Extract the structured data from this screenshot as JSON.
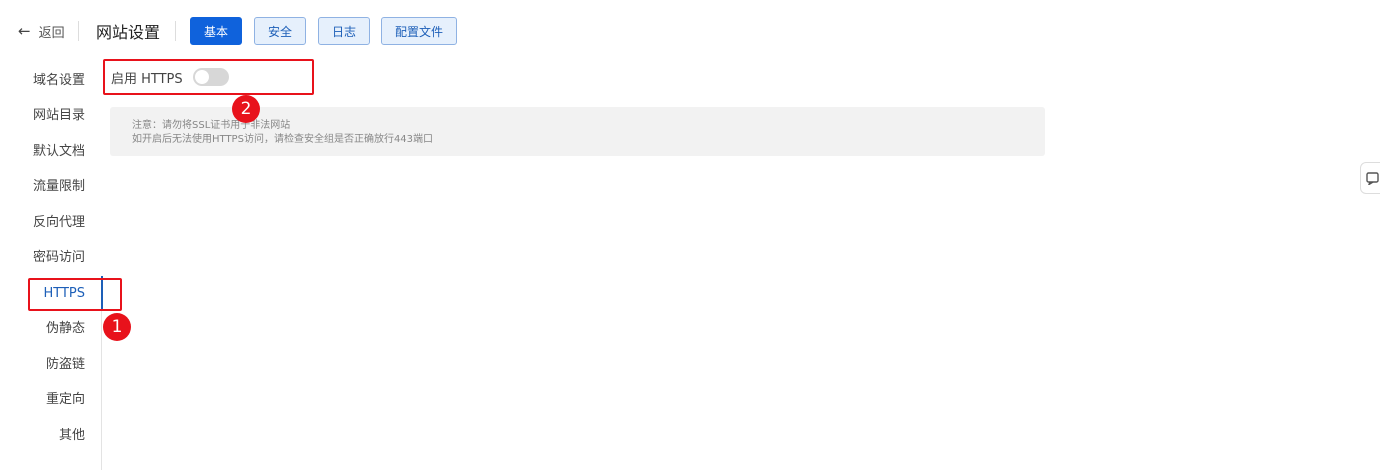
{
  "header": {
    "back_label": "返回",
    "title": "网站设置",
    "tabs": [
      {
        "label": "基本",
        "active": true
      },
      {
        "label": "安全",
        "active": false
      },
      {
        "label": "日志",
        "active": false
      },
      {
        "label": "配置文件",
        "active": false
      }
    ]
  },
  "sidebar": {
    "items": [
      {
        "label": "域名设置"
      },
      {
        "label": "网站目录"
      },
      {
        "label": "默认文档"
      },
      {
        "label": "流量限制"
      },
      {
        "label": "反向代理"
      },
      {
        "label": "密码访问"
      },
      {
        "label": "HTTPS",
        "active": true
      },
      {
        "label": "伪静态"
      },
      {
        "label": "防盗链"
      },
      {
        "label": "重定向"
      },
      {
        "label": "其他"
      }
    ]
  },
  "https": {
    "toggle_label": "启用 HTTPS",
    "enabled": false,
    "notice_lines": [
      "注意：请勿将SSL证书用于非法网站",
      "如开启后无法使用HTTPS访问，请检查安全组是否正确放行443端口"
    ]
  },
  "annotations": {
    "step1": "1",
    "step2": "2"
  },
  "colors": {
    "primary": "#0f62dc",
    "active_text": "#1d5fb8",
    "annotation": "#e8121b"
  }
}
